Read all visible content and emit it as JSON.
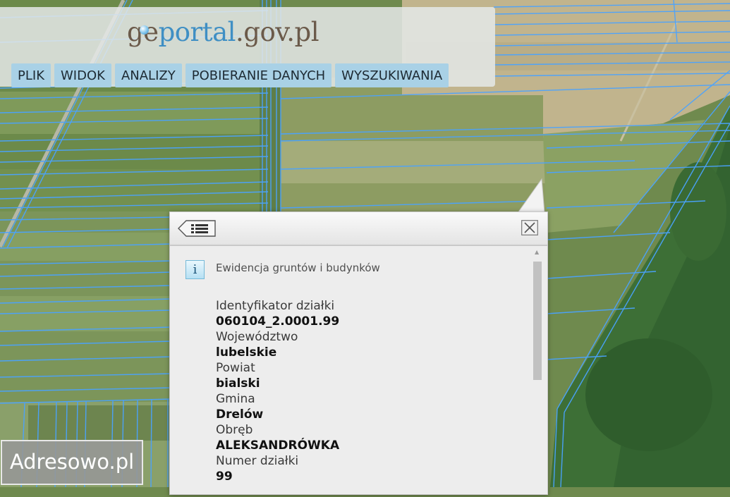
{
  "header": {
    "logo": {
      "part1": "ge",
      "part2": "portal",
      "part3": ".gov.pl"
    },
    "menu": [
      "PLIK",
      "WIDOK",
      "ANALIZY",
      "POBIERANIE DANYCH",
      "WYSZUKIWANIA"
    ]
  },
  "popup": {
    "source": "Ewidencja gruntów i budynków",
    "info_icon": "i",
    "fields": [
      {
        "label": "Identyfikator działki",
        "value": "060104_2.0001.99"
      },
      {
        "label": "Województwo",
        "value": "lubelskie"
      },
      {
        "label": "Powiat",
        "value": "bialski"
      },
      {
        "label": "Gmina",
        "value": "Drelów"
      },
      {
        "label": "Obręb",
        "value": "ALEKSANDRÓWKA"
      },
      {
        "label": "Numer działki",
        "value": "99"
      }
    ],
    "icons": {
      "back": "back-list-icon",
      "close": "close-icon"
    }
  },
  "badge": {
    "text": "Adresowo.pl"
  },
  "colors": {
    "parcel_line": "#4aa3ff",
    "menu_bg": "#a9d1e6",
    "logo_brown": "#6b5a4a",
    "logo_blue": "#3f8fc4"
  }
}
